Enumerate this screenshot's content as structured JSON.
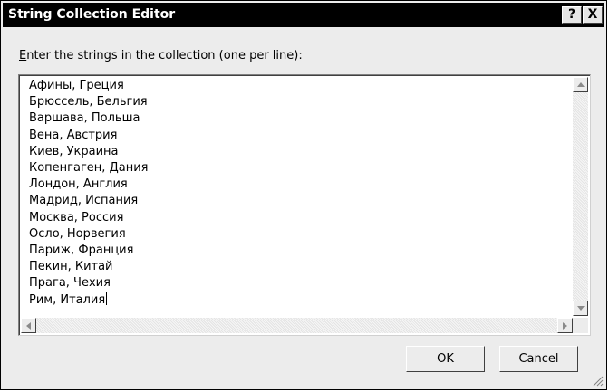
{
  "window": {
    "title": "String Collection Editor",
    "help_label": "?",
    "close_label": "X"
  },
  "prompt": {
    "accesskey": "E",
    "rest": "nter the strings in the collection (one per line):"
  },
  "editor": {
    "lines": [
      "Афины, Греция",
      "Брюссель, Бельгия",
      "Варшава, Польша",
      "Вена, Австрия",
      "Киев, Украина",
      "Копенгаген, Дания",
      "Лондон, Англия",
      "Мадрид, Испания",
      "Москва, Россия",
      "Осло, Норвегия",
      "Париж, Франция",
      "Пекин, Китай",
      "Прага, Чехия",
      "Рим, Италия"
    ]
  },
  "buttons": {
    "ok": "OK",
    "cancel": "Cancel"
  }
}
